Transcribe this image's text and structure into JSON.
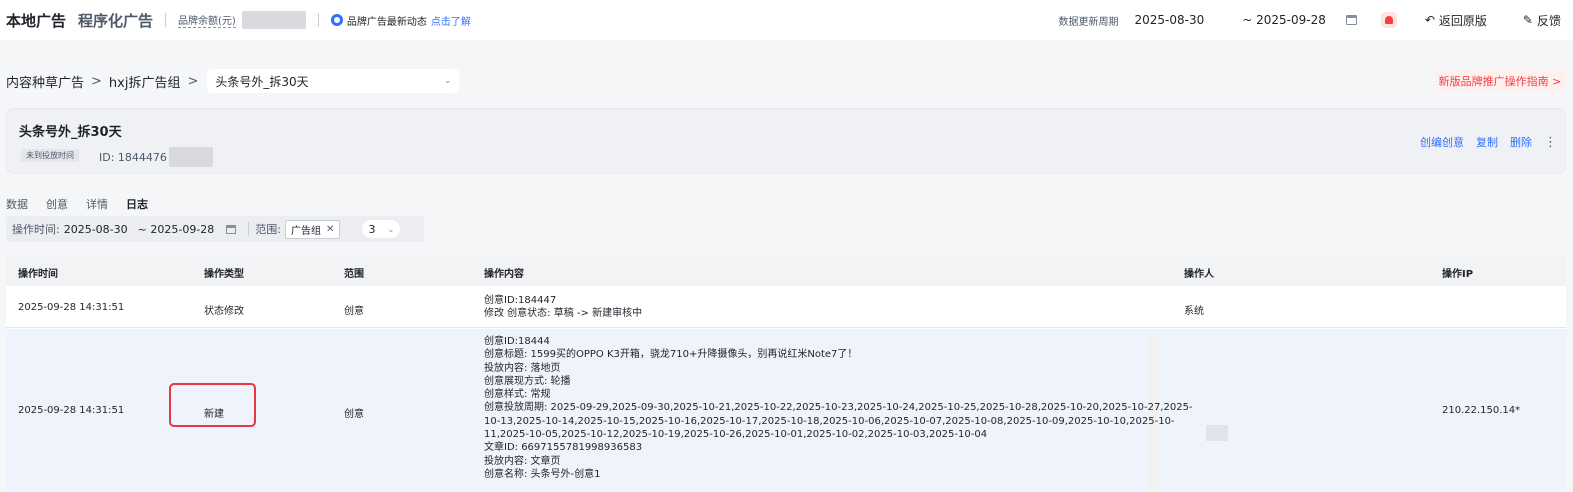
{
  "header": {
    "brand_main": "本地广告",
    "brand_sub": "程序化广告",
    "balance_label": "品牌余额(元)",
    "news_text": "品牌广告最新动态",
    "news_link": "点击了解",
    "period_label": "数据更新周期",
    "date_start": "2025-08-30",
    "date_end": "~ 2025-09-28",
    "back_label": "返回原版",
    "feedback_label": "反馈"
  },
  "breadcrumb": {
    "items": [
      "内容种草广告",
      "hxj拆广告组"
    ],
    "selected": "头条号外_拆30天",
    "guide_link": "新版品牌推广操作指南 >"
  },
  "card": {
    "title": "头条号外_拆30天",
    "status": "未到投放时间",
    "id_prefix": "ID: 1844476",
    "actions": [
      "创编创意",
      "复制",
      "删除"
    ]
  },
  "tabs": [
    "数据",
    "创意",
    "详情",
    "日志"
  ],
  "active_tab": "日志",
  "filter": {
    "time_label": "操作时间:",
    "date_start": "2025-08-30",
    "date_end": "~ 2025-09-28",
    "scope_label": "范围:",
    "scope_tag": "广告组",
    "count": "3"
  },
  "table": {
    "columns": [
      "操作时间",
      "操作类型",
      "范围",
      "操作内容",
      "操作人",
      "操作IP"
    ],
    "rows": [
      {
        "time": "2025-09-28 14:31:51",
        "type": "状态修改",
        "scope": "创意",
        "content": [
          "创意ID:184447",
          "修改 创意状态: 草稿 -> 新建审核中"
        ],
        "operator": "系统",
        "ip": ""
      },
      {
        "time": "2025-09-28 14:31:51",
        "type": "新建",
        "scope": "创意",
        "content": [
          "创意ID:18444",
          "创意标题: 1599买的OPPO K3开箱，骁龙710+升降摄像头，别再说红米Note7了！",
          "投放内容: 落地页",
          "创意展现方式: 轮播",
          "创意样式: 常规",
          "创意投放周期: 2025-09-29,2025-09-30,2025-10-21,2025-10-22,2025-10-23,2025-10-24,2025-10-25,2025-10-28,2025-10-20,2025-10-27,2025-",
          "10-13,2025-10-14,2025-10-15,2025-10-16,2025-10-17,2025-10-18,2025-10-06,2025-10-07,2025-10-08,2025-10-09,2025-10-10,2025-10-",
          "11,2025-10-05,2025-10-12,2025-10-19,2025-10-26,2025-10-01,2025-10-02,2025-10-03,2025-10-04",
          "文章ID: 6697155781998936583",
          "投放内容: 文章页",
          "创意名称: 头条号外-创意1"
        ],
        "operator": "",
        "ip": "210.22.150.14*"
      }
    ]
  }
}
